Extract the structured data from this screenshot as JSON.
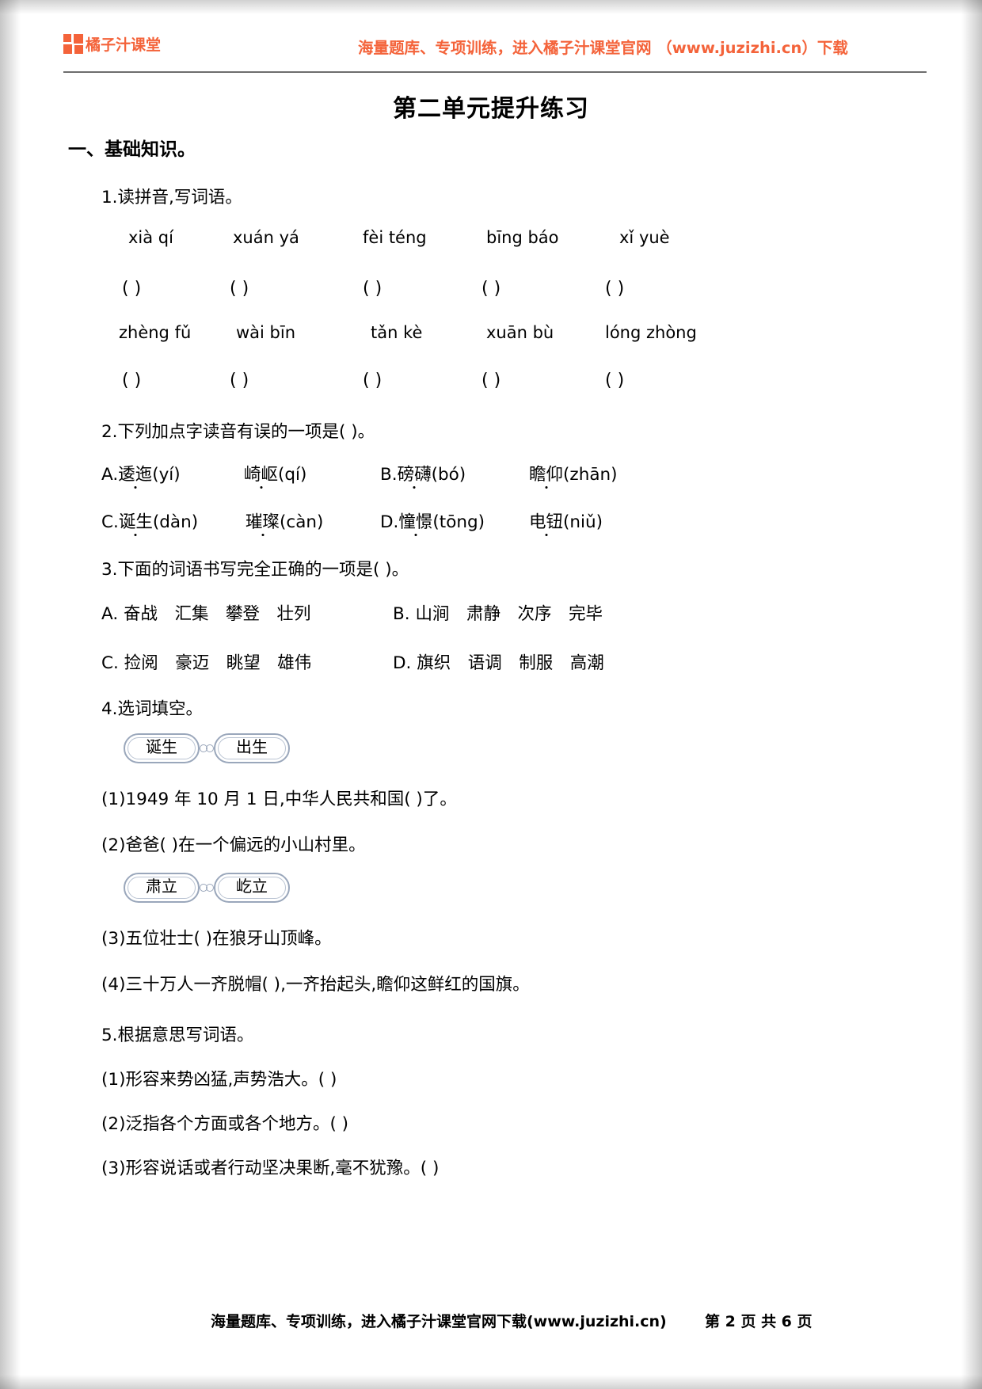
{
  "header": {
    "logo_text": "橘子汁课堂",
    "promo": "海量题库、专项训练，进入橘子汁课堂官网 （www.juzizhi.cn）下载",
    "accent_color": "#f4633a"
  },
  "title": "第二单元提升练习",
  "section": {
    "number_label": "一、",
    "name": "基础知识。"
  },
  "q1": {
    "prompt": "1.读拼音,写词语。",
    "row1_pinyin": [
      "xià qí",
      "xuán yá",
      "fèi téng",
      "bīng báo",
      "xǐ yuè"
    ],
    "row2_pinyin": [
      "zhèng fǔ",
      "wài bīn",
      "tǎn kè",
      "xuān bù",
      "lóng zhòng"
    ],
    "blank": "(            )"
  },
  "q2": {
    "prompt": "2.下列加点字读音有误的一项是(        )。",
    "options": [
      {
        "label": "A.",
        "items": [
          {
            "word": "逶迤",
            "pinyin": "(yí)"
          },
          {
            "word": "崎岖",
            "pinyin": "(qí)"
          }
        ]
      },
      {
        "label": "B.",
        "items": [
          {
            "word": "磅礴",
            "pinyin": "(bó)"
          },
          {
            "word": "瞻仰",
            "pinyin": "(zhān)"
          }
        ]
      },
      {
        "label": "C.",
        "items": [
          {
            "word": "诞生",
            "pinyin": "(dàn)"
          },
          {
            "word": "璀璨",
            "pinyin": "(càn)"
          }
        ]
      },
      {
        "label": "D.",
        "items": [
          {
            "word": "憧憬",
            "pinyin": "(tōng)"
          },
          {
            "word": "电钮",
            "pinyin": "(niǔ)"
          }
        ]
      }
    ]
  },
  "q3": {
    "prompt": "3.下面的词语书写完全正确的一项是(        )。",
    "options": [
      {
        "label": "A.",
        "words": "奋战　汇集　攀登　壮列"
      },
      {
        "label": "B.",
        "words": "山涧　肃静　次序　完毕"
      },
      {
        "label": "C.",
        "words": "捡阅　豪迈　眺望　雄伟"
      },
      {
        "label": "D.",
        "words": "旗织　语调　制服　高潮"
      }
    ]
  },
  "q4": {
    "prompt": "4.选词填空。",
    "pills_group1": [
      "诞生",
      "出生"
    ],
    "pills_group2": [
      "肃立",
      "屹立"
    ],
    "items": [
      "(1)1949 年 10 月 1 日,中华人民共和国(             )了。",
      "(2)爸爸(             )在一个偏远的小山村里。",
      "(3)五位壮士(             )在狼牙山顶峰。",
      "(4)三十万人一齐脱帽(             ),一齐抬起头,瞻仰这鲜红的国旗。"
    ]
  },
  "q5": {
    "prompt": "5.根据意思写词语。",
    "items": [
      "(1)形容来势凶猛,声势浩大。(              )",
      "(2)泛指各个方面或各个地方。(              )",
      "(3)形容说话或者行动坚决果断,毫不犹豫。(              )"
    ]
  },
  "footer": {
    "promo": "海量题库、专项训练，进入橘子汁课堂官网下载(www.juzizhi.cn)",
    "page": "第 2 页 共 6 页"
  }
}
